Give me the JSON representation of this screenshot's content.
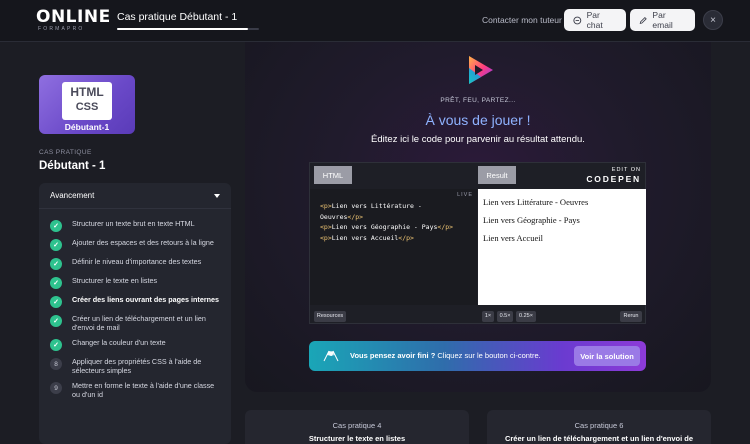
{
  "header": {
    "logo_text": "ONLINE",
    "logo_sub": "FORMAPRO",
    "course_title": "Cas pratique Débutant - 1",
    "progress": 0.92,
    "contact_label": "Contacter mon tuteur :",
    "chat_label": "Par chat",
    "email_label": "Par email",
    "close_label": "×"
  },
  "sidebar": {
    "thumb": {
      "html": "HTML",
      "css": "CSS",
      "level": "Débutant-1"
    },
    "kicker": "CAS PRATIQUE",
    "title": "Débutant - 1",
    "panel_title": "Avancement",
    "steps": [
      {
        "label": "Structurer un texte brut en texte HTML",
        "status": "done",
        "num": ""
      },
      {
        "label": "Ajouter des espaces et des retours à la ligne",
        "status": "done",
        "num": ""
      },
      {
        "label": "Définir le niveau d'importance des textes",
        "status": "done",
        "num": ""
      },
      {
        "label": "Structurer le texte en listes",
        "status": "done",
        "num": ""
      },
      {
        "label": "Créer des liens ouvrant des pages internes",
        "status": "done",
        "num": ""
      },
      {
        "label": "Créer un lien de téléchargement et un lien d'envoi de mail",
        "status": "done",
        "num": ""
      },
      {
        "label": "Changer la couleur d'un texte",
        "status": "done",
        "num": ""
      },
      {
        "label": "Appliquer des propriétés CSS à l'aide de sélecteurs simples",
        "status": "todo",
        "num": "8"
      },
      {
        "label": "Mettre en forme le texte à l'aide d'une classe ou d'un id",
        "status": "todo",
        "num": "9"
      }
    ]
  },
  "main": {
    "kicker": "PRÊT, FEU, PARTEZ...",
    "heading": "À vous de jouer !",
    "subheading": "Éditez ici le code pour parvenir au résultat attendu."
  },
  "codepen": {
    "tab_html": "HTML",
    "tab_result": "Result",
    "brand_edit": "EDIT ON",
    "brand_name": "CODEPEN",
    "live": "LIVE",
    "code": [
      {
        "open": "<p>",
        "text": "Lien vers Littérature - Oeuvres",
        "close": "</p>"
      },
      {
        "open": "<p>",
        "text": "Lien vers Géographie - Pays",
        "close": "</p>"
      },
      {
        "open": "<p>",
        "text": "Lien vers Accueil",
        "close": "</p>"
      }
    ],
    "code_line1a": "<p>",
    "code_line1b": "Lien vers Littérature -",
    "code_line1c": "Oeuvres",
    "code_line1d": "</p>",
    "preview": [
      "Lien vers Littérature - Oeuvres",
      "Lien vers Géographie - Pays",
      "Lien vers Accueil"
    ],
    "resources": "Resources",
    "zoom_1x": "1×",
    "zoom_05x": "0.5×",
    "zoom_025x": "0.25×",
    "rerun": "Rerun"
  },
  "banner": {
    "bold": "Vous pensez avoir fini ?",
    "text": " Cliquez sur le bouton ci-contre.",
    "button": "Voir la solution"
  },
  "nav_cards": {
    "prev_kicker": "Cas pratique 4",
    "prev_title": "Structurer le texte en listes",
    "next_kicker": "Cas pratique 6",
    "next_title": "Créer un lien de téléchargement et un lien d'envoi de"
  },
  "colors": {
    "accent": "#8fb2ff",
    "done": "#2ec28e",
    "solution_button": "#9a7ae6"
  }
}
